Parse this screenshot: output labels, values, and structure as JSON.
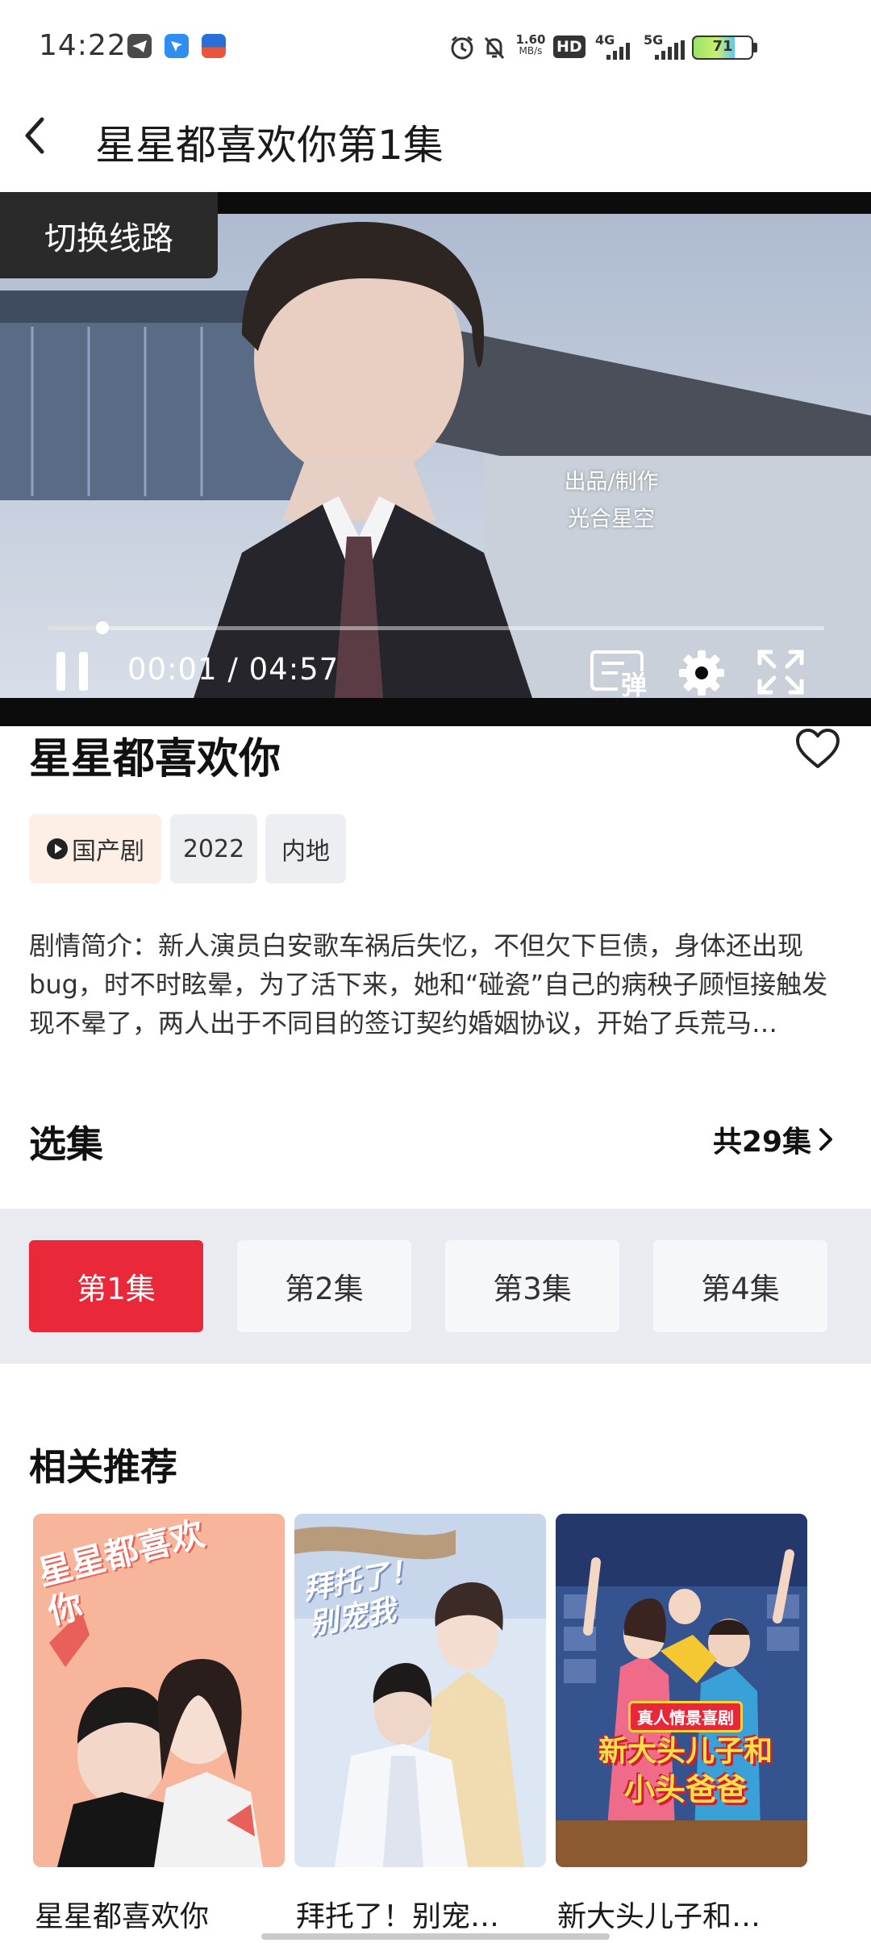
{
  "status_bar": {
    "time": "14:22",
    "net_speed_value": "1.60",
    "net_speed_unit": "MB/s",
    "hd_label": "HD",
    "net1": "4G",
    "net2": "5G",
    "battery": "71"
  },
  "header": {
    "title": "星星都喜欢你第1集"
  },
  "player": {
    "switch_line_label": "切换线路",
    "credit_line1": "出品/制作",
    "credit_line2": "光合星空",
    "time_display": "00:01 / 04:57",
    "progress_fraction": 0.07,
    "danmaku_label": "弹"
  },
  "show": {
    "title": "星星都喜欢你",
    "tags": [
      "国产剧",
      "2022",
      "内地"
    ],
    "synopsis": "剧情简介：新人演员白安歌车祸后失忆，不但欠下巨债，身体还出现bug，时不时眩晕，为了活下来，她和“碰瓷”自己的病秧子顾恒接触发现不晕了，两人出于不同目的签订契约婚姻协议，开始了兵荒马…"
  },
  "episodes": {
    "section_title": "选集",
    "count_label": "共29集",
    "items": [
      "第1集",
      "第2集",
      "第3集",
      "第4集"
    ],
    "selected_index": 0
  },
  "recommend": {
    "section_title": "相关推荐",
    "items": [
      {
        "label": "星星都喜欢你",
        "poster_text": "星星都喜欢你"
      },
      {
        "label": "拜托了！别宠…",
        "poster_text": "拜托了！别宠我"
      },
      {
        "label": "新大头儿子和…",
        "poster_badge": "真人情景喜剧",
        "poster_text1": "新大头儿子和",
        "poster_text2": "小头爸爸"
      }
    ]
  },
  "colors": {
    "accent_red": "#e9283a",
    "tag_primary_bg": "#fdeee6",
    "tag_bg": "#eceef2",
    "episode_bar_bg": "#e9ebf1"
  }
}
